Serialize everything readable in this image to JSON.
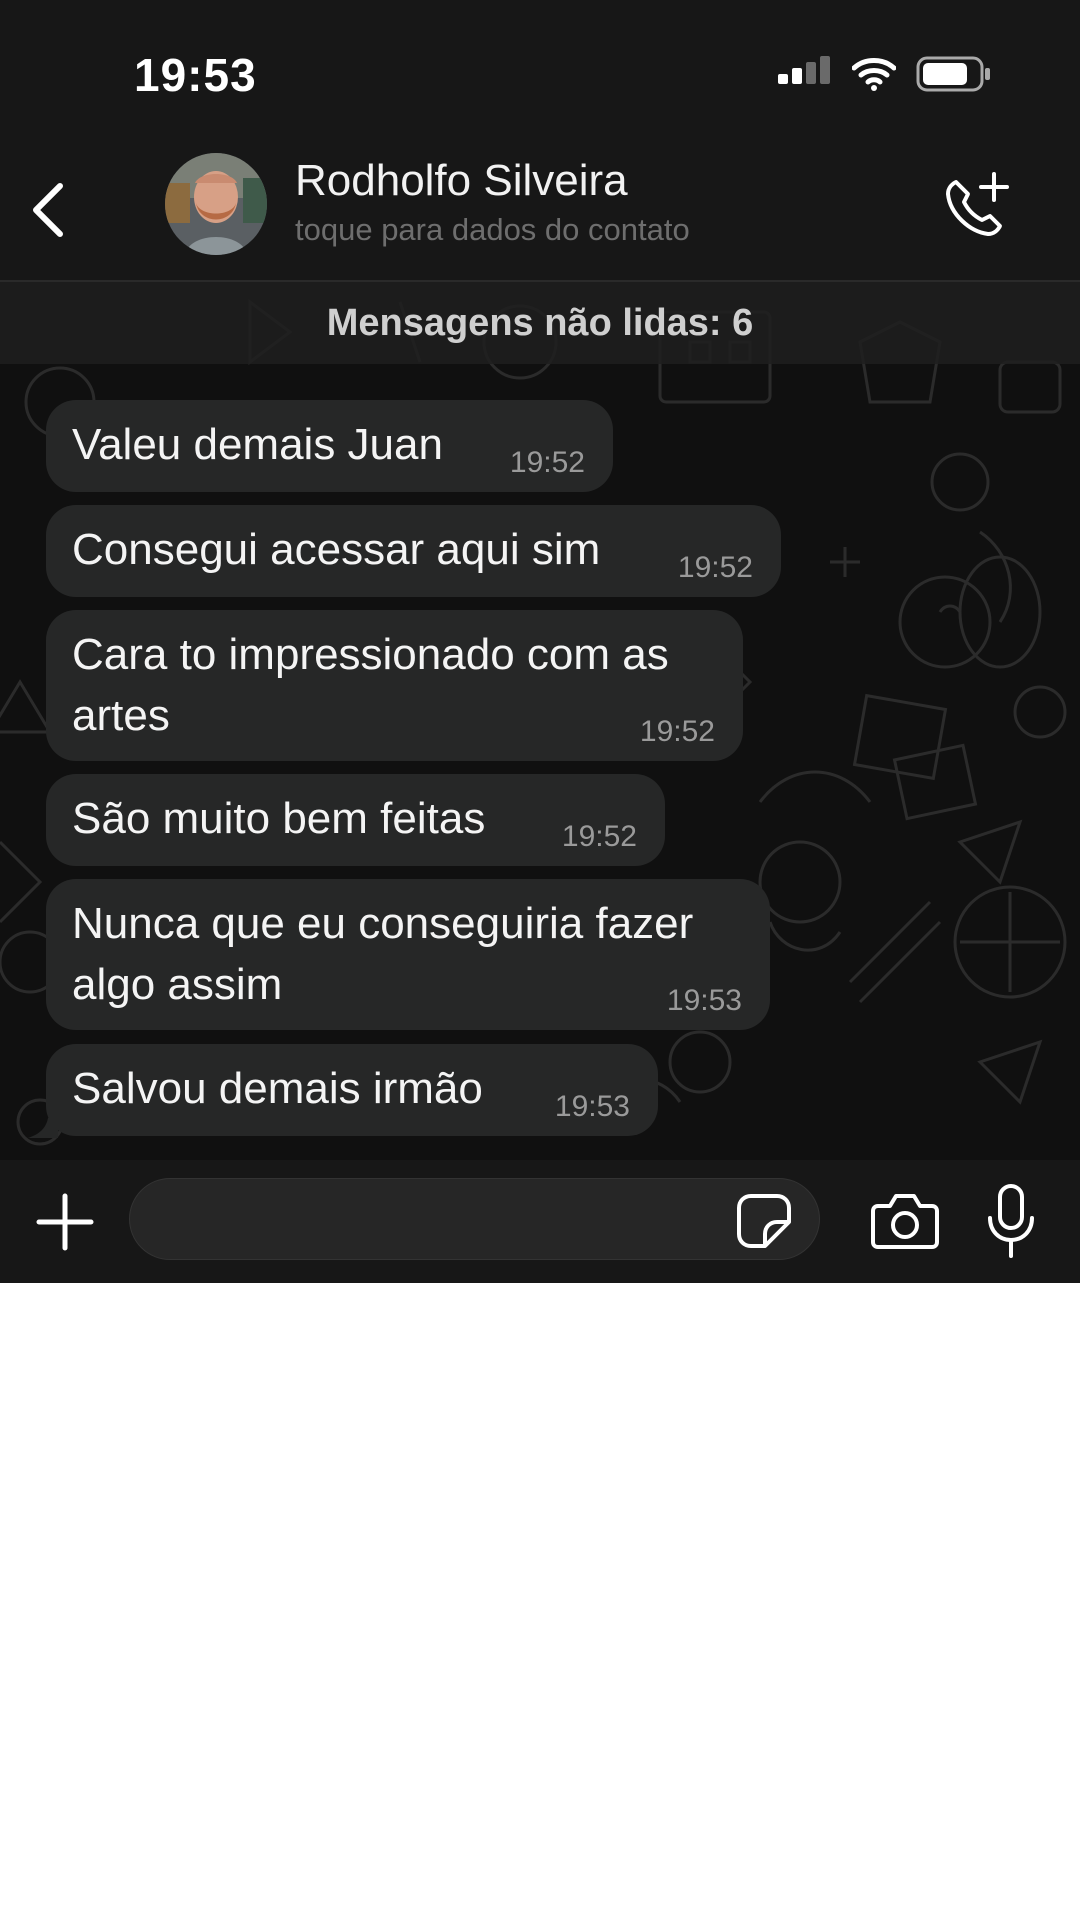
{
  "status_bar": {
    "time": "19:53",
    "icons": [
      "cellular-signal-icon",
      "wifi-icon",
      "battery-icon"
    ]
  },
  "header": {
    "back_icon": "chevron-left-icon",
    "contact_name": "Rodholfo Silveira",
    "contact_subtitle": "toque para dados do contato",
    "call_icon": "phone-plus-icon"
  },
  "unread_banner": "Mensagens não lidas: 6",
  "messages": [
    {
      "text": "Valeu demais Juan",
      "time": "19:52"
    },
    {
      "text": "Consegui acessar aqui sim",
      "time": "19:52"
    },
    {
      "text": "Cara to impressionado com as artes",
      "time": "19:52"
    },
    {
      "text": "São muito bem feitas",
      "time": "19:52"
    },
    {
      "text": "Nunca que eu conseguiria fazer algo assim",
      "time": "19:53"
    },
    {
      "text": "Salvou demais irmão",
      "time": "19:53"
    }
  ],
  "input_bar": {
    "placeholder": "",
    "icons": [
      "plus-icon",
      "sticker-icon",
      "camera-icon",
      "microphone-icon"
    ]
  },
  "colors": {
    "background": "#101010",
    "bubble": "#262727",
    "header": "#171717",
    "text": "#f4f4f4",
    "muted": "#9a9a9a"
  }
}
